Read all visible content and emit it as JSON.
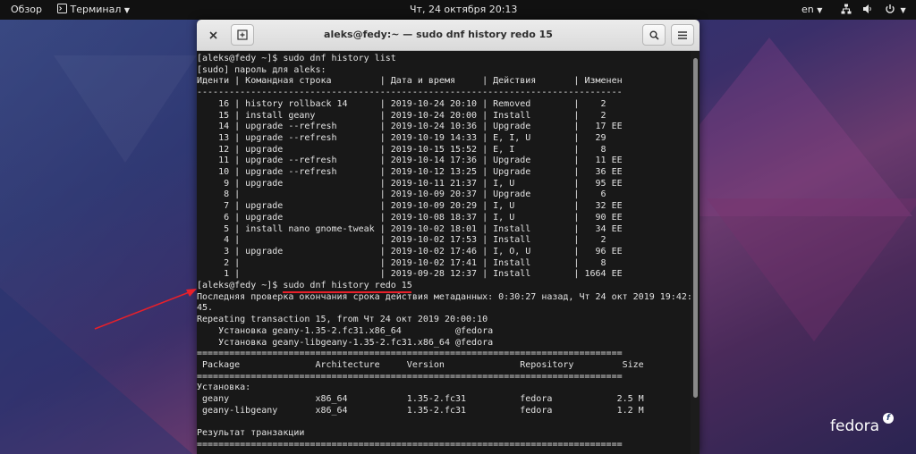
{
  "topbar": {
    "activities": "Обзор",
    "app_menu": "Терминал",
    "clock": "Чт, 24 октября  20:13",
    "input_lang": "en"
  },
  "window": {
    "title": "aleks@fedy:~ — sudo dnf history redo 15"
  },
  "terminal": {
    "lines": [
      "[aleks@fedy ~]$ sudo dnf history list",
      "[sudo] пароль для aleks:",
      "Иденти | Командная строка         | Дата и время     | Действия       | Изменен",
      "-------------------------------------------------------------------------------",
      "    16 | history rollback 14      | 2019-10-24 20:10 | Removed        |    2",
      "    15 | install geany            | 2019-10-24 20:00 | Install        |    2",
      "    14 | upgrade --refresh        | 2019-10-24 10:36 | Upgrade        |   17 EE",
      "    13 | upgrade --refresh        | 2019-10-19 14:33 | E, I, U        |   29",
      "    12 | upgrade                  | 2019-10-15 15:52 | E, I           |    8",
      "    11 | upgrade --refresh        | 2019-10-14 17:36 | Upgrade        |   11 EE",
      "    10 | upgrade --refresh        | 2019-10-12 13:25 | Upgrade        |   36 EE",
      "     9 | upgrade                  | 2019-10-11 21:37 | I, U           |   95 EE",
      "     8 |                          | 2019-10-09 20:37 | Upgrade        |    6",
      "     7 | upgrade                  | 2019-10-09 20:29 | I, U           |   32 EE",
      "     6 | upgrade                  | 2019-10-08 18:37 | I, U           |   90 EE",
      "     5 | install nano gnome-tweak | 2019-10-02 18:01 | Install        |   34 EE",
      "     4 |                          | 2019-10-02 17:53 | Install        |    2",
      "     3 | upgrade                  | 2019-10-02 17:46 | I, O, U        |   96 EE",
      "     2 |                          | 2019-10-02 17:41 | Install        |    8",
      "     1 |                          | 2019-09-28 12:37 | Install        | 1664 EE",
      "[aleks@fedy ~]$ sudo dnf history redo 15",
      "Последняя проверка окончания срока действия метаданных: 0:30:27 назад, Чт 24 окт 2019 19:42:",
      "45.",
      "Repeating transaction 15, from Чт 24 окт 2019 20:00:10",
      "    Установка geany-1.35-2.fc31.x86_64          @fedora",
      "    Установка geany-libgeany-1.35-2.fc31.x86_64 @fedora",
      "===============================================================================",
      " Package              Architecture     Version              Repository         Size",
      "===============================================================================",
      "Установка:",
      " geany                x86_64           1.35-2.fc31          fedora            2.5 M",
      " geany-libgeany       x86_64           1.35-2.fc31          fedora            1.2 M",
      "",
      "Результат транзакции",
      "==============================================================================="
    ],
    "highlight_color": "#e8202a"
  },
  "desktop": {
    "logo_text": "fedora",
    "logo_badge": "f"
  }
}
